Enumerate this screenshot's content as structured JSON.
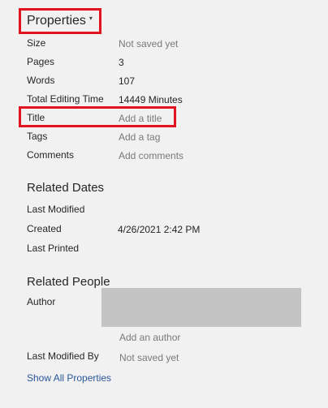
{
  "header": {
    "title": "Properties",
    "caret": "▾"
  },
  "properties": {
    "size": {
      "label": "Size",
      "value": "Not saved yet"
    },
    "pages": {
      "label": "Pages",
      "value": "3"
    },
    "words": {
      "label": "Words",
      "value": "107"
    },
    "editing_time": {
      "label": "Total Editing Time",
      "value": "14449 Minutes"
    },
    "title": {
      "label": "Title",
      "placeholder": "Add a title"
    },
    "tags": {
      "label": "Tags",
      "placeholder": "Add a tag"
    },
    "comments": {
      "label": "Comments",
      "placeholder": "Add comments"
    }
  },
  "related_dates": {
    "heading": "Related Dates",
    "last_modified": {
      "label": "Last Modified",
      "value": ""
    },
    "created": {
      "label": "Created",
      "value": "4/26/2021 2:42 PM"
    },
    "last_printed": {
      "label": "Last Printed",
      "value": ""
    }
  },
  "related_people": {
    "heading": "Related People",
    "author": {
      "label": "Author"
    },
    "add_author": "Add an author",
    "last_modified_by": {
      "label": "Last Modified By",
      "value": "Not saved yet"
    }
  },
  "show_all_link": "Show All Properties",
  "colors": {
    "highlight": "#e2121f",
    "link": "#2b579a",
    "redacted": "#c4c4c4"
  }
}
